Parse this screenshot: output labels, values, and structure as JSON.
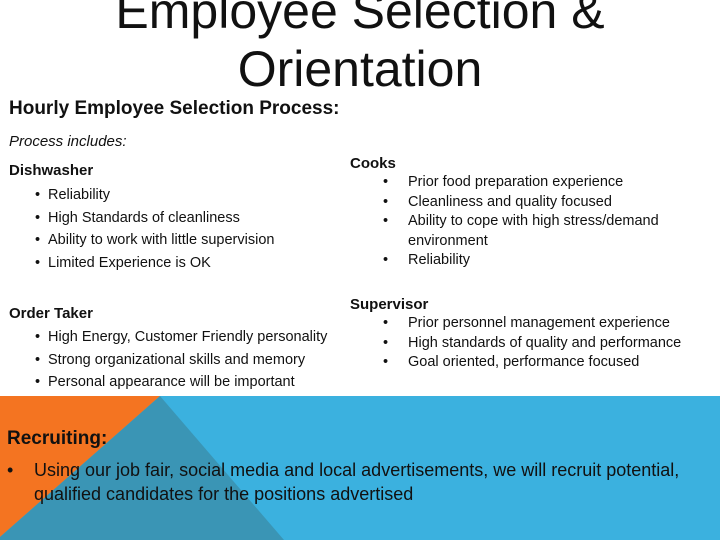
{
  "title": "Employee Selection & Orientation",
  "subtitle": "Hourly Employee Selection Process:",
  "intro": "Process includes:",
  "roles": {
    "dishwasher": {
      "name": "Dishwasher",
      "items": [
        "Reliability",
        "High Standards of cleanliness",
        "Ability to work with little supervision",
        "Limited Experience is OK"
      ]
    },
    "cooks": {
      "name": "Cooks",
      "items": [
        "Prior food preparation experience",
        "Cleanliness and quality focused",
        "Ability to cope with high stress/demand environment",
        "Reliability"
      ]
    },
    "order_taker": {
      "name": "Order Taker",
      "items": [
        "High Energy, Customer Friendly personality",
        "Strong organizational skills and memory",
        "Personal appearance will be important"
      ]
    },
    "supervisor": {
      "name": "Supervisor",
      "items": [
        "Prior personnel management experience",
        "High standards of quality and performance",
        "Goal oriented, performance focused"
      ]
    }
  },
  "recruiting": {
    "title": "Recruiting:",
    "items": [
      "Using our job fair, social media and local advertisements, we will recruit potential, qualified candidates for the positions advertised"
    ]
  },
  "bullet": "•",
  "colors": {
    "orange": "#F47421",
    "dark_blue": "#3A95B5",
    "light_blue": "#3BB1DF"
  }
}
